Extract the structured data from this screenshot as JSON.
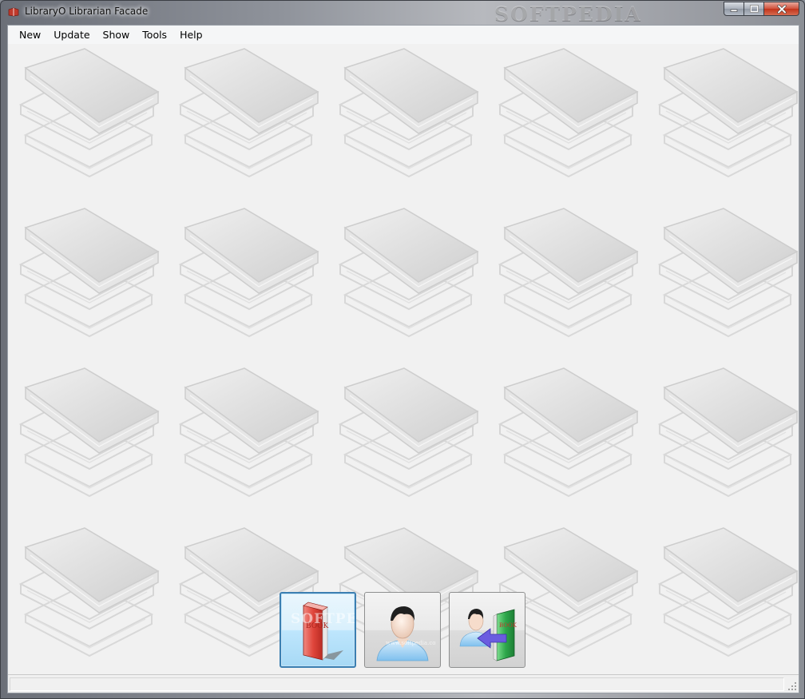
{
  "window": {
    "title": "LibraryO Librarian Facade",
    "watermark": "SOFTPEDIA"
  },
  "menu": {
    "items": [
      {
        "label": "New"
      },
      {
        "label": "Update"
      },
      {
        "label": "Show"
      },
      {
        "label": "Tools"
      },
      {
        "label": "Help"
      }
    ]
  },
  "actions": [
    {
      "icon": "book-icon",
      "icon_label": "BOOK"
    },
    {
      "icon": "user-icon"
    },
    {
      "icon": "return-book-icon",
      "icon_label": "BOOK"
    }
  ],
  "overlay_watermark": {
    "text": "SOFTPEDIA",
    "url": "www.softpedia.com"
  },
  "colors": {
    "focus_border": "#3c7fb1",
    "book_red": "#d9453d",
    "book_green": "#2ea84b",
    "arrow_purple": "#6a5ce0",
    "close_red": "#c2341b"
  }
}
